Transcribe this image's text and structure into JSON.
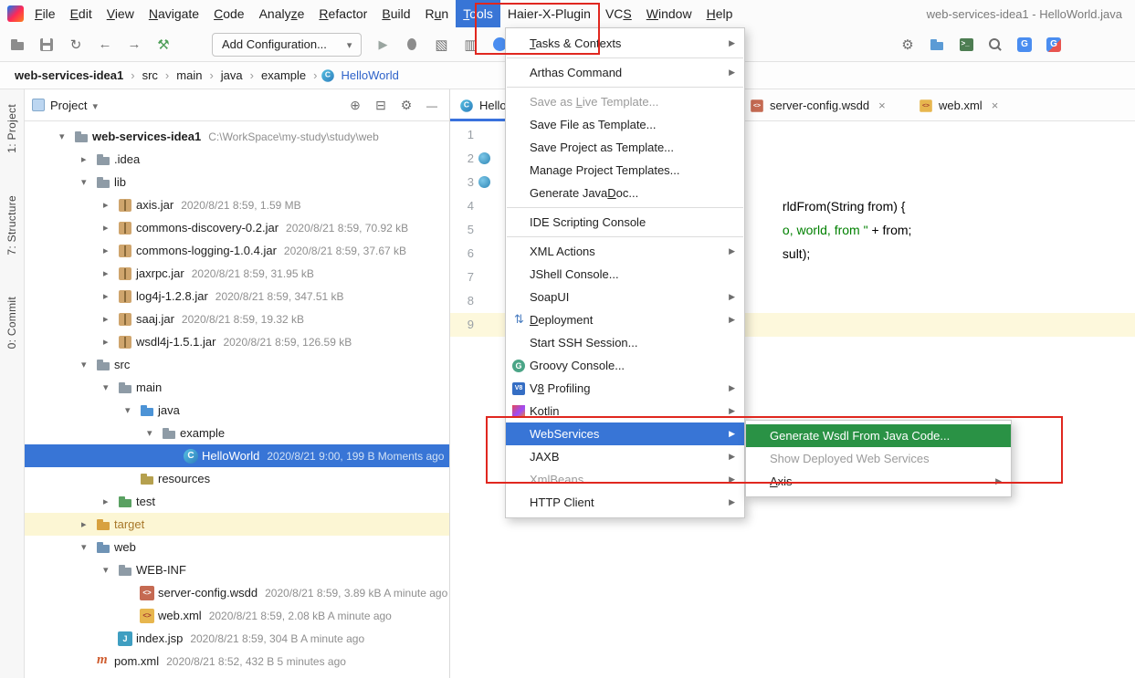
{
  "window_title": "web-services-idea1 - HelloWorld.java",
  "menubar": {
    "items": [
      {
        "label": "File"
      },
      {
        "label": "Edit"
      },
      {
        "label": "View"
      },
      {
        "label": "Navigate"
      },
      {
        "label": "Code"
      },
      {
        "label": "Analyze"
      },
      {
        "label": "Refactor"
      },
      {
        "label": "Build"
      },
      {
        "label": "Run"
      },
      {
        "label": "Tools",
        "selected": true
      },
      {
        "label": "Haier-X-Plugin"
      },
      {
        "label": "VCS"
      },
      {
        "label": "Window"
      },
      {
        "label": "Help"
      }
    ]
  },
  "toolbar": {
    "add_configuration_label": "Add Configuration..."
  },
  "breadcrumbs": {
    "items": [
      "web-services-idea1",
      "src",
      "main",
      "java",
      "example",
      "HelloWorld"
    ]
  },
  "stripe": {
    "items": [
      "1: Project",
      "7: Structure",
      "0: Commit"
    ]
  },
  "project_panel": {
    "title": "Project",
    "rows": [
      {
        "name": "web-services-idea1",
        "meta": "C:\\WorkSpace\\my-study\\study\\web"
      },
      {
        "name": ".idea"
      },
      {
        "name": "lib"
      },
      {
        "name": "axis.jar",
        "meta": "2020/8/21 8:59, 1.59 MB"
      },
      {
        "name": "commons-discovery-0.2.jar",
        "meta": "2020/8/21 8:59, 70.92 kB"
      },
      {
        "name": "commons-logging-1.0.4.jar",
        "meta": "2020/8/21 8:59, 37.67 kB"
      },
      {
        "name": "jaxrpc.jar",
        "meta": "2020/8/21 8:59, 31.95 kB"
      },
      {
        "name": "log4j-1.2.8.jar",
        "meta": "2020/8/21 8:59, 347.51 kB"
      },
      {
        "name": "saaj.jar",
        "meta": "2020/8/21 8:59, 19.32 kB"
      },
      {
        "name": "wsdl4j-1.5.1.jar",
        "meta": "2020/8/21 8:59, 126.59 kB"
      },
      {
        "name": "src"
      },
      {
        "name": "main"
      },
      {
        "name": "java"
      },
      {
        "name": "example"
      },
      {
        "name": "HelloWorld",
        "meta": "2020/8/21 9:00, 199 B Moments ago"
      },
      {
        "name": "resources"
      },
      {
        "name": "test"
      },
      {
        "name": "target"
      },
      {
        "name": "web"
      },
      {
        "name": "WEB-INF"
      },
      {
        "name": "server-config.wsdd",
        "meta": "2020/8/21 8:59, 3.89 kB A minute ago"
      },
      {
        "name": "web.xml",
        "meta": "2020/8/21 8:59, 2.08 kB A minute ago"
      },
      {
        "name": "index.jsp",
        "meta": "2020/8/21 8:59, 304 B A minute ago"
      },
      {
        "name": "pom.xml",
        "meta": "2020/8/21 8:52, 432 B 5 minutes ago"
      }
    ]
  },
  "editor": {
    "tabs": {
      "tab1": "HelloWorld.java",
      "tab2": "server-config.wsdd",
      "tab3": "web.xml"
    },
    "line_numbers": [
      "1",
      "2",
      "3",
      "4",
      "5",
      "6",
      "7",
      "8",
      "9"
    ],
    "code": {
      "line3": "rldFrom(String from) {",
      "line4_string": "o, world, from \" ",
      "line4_code": "+ from;",
      "line5": "sult);"
    }
  },
  "tools_menu": {
    "items": [
      {
        "label": "Tasks & Contexts",
        "submenu": true
      },
      {
        "label": "Arthas Command",
        "submenu": true
      },
      {
        "label": "Save as Live Template...",
        "disabled": true
      },
      {
        "label": "Save File as Template..."
      },
      {
        "label": "Save Project as Template..."
      },
      {
        "label": "Manage Project Templates..."
      },
      {
        "label": "Generate JavaDoc..."
      },
      {
        "label": "IDE Scripting Console"
      },
      {
        "label": "XML Actions",
        "submenu": true
      },
      {
        "label": "JShell Console..."
      },
      {
        "label": "SoapUI",
        "submenu": true
      },
      {
        "label": "Deployment",
        "submenu": true,
        "icon": "deployment-icon"
      },
      {
        "label": "Start SSH Session..."
      },
      {
        "label": "Groovy Console...",
        "icon": "groovy-icon"
      },
      {
        "label": "V8 Profiling",
        "submenu": true,
        "icon": "v8-profiling-icon"
      },
      {
        "label": "Kotlin",
        "submenu": true,
        "icon": "kotlin-icon"
      },
      {
        "label": "WebServices",
        "submenu": true,
        "selected": true
      },
      {
        "label": "JAXB",
        "submenu": true
      },
      {
        "label": "XmlBeans",
        "submenu": true,
        "disabled": true
      },
      {
        "label": "HTTP Client",
        "submenu": true
      }
    ]
  },
  "webservices_submenu": {
    "items": [
      {
        "label": "Generate Wsdl From Java Code...",
        "selected": true
      },
      {
        "label": "Show Deployed Web Services",
        "disabled": true
      },
      {
        "label": "Axis",
        "submenu": true
      }
    ]
  },
  "colors": {
    "selection_blue": "#3875d6",
    "submenu_selection_green": "#2a9245",
    "annotation_red": "#e0271f",
    "caret_line_yellow": "#fdf8dc",
    "target_row_yellow": "#fcf6d4"
  }
}
